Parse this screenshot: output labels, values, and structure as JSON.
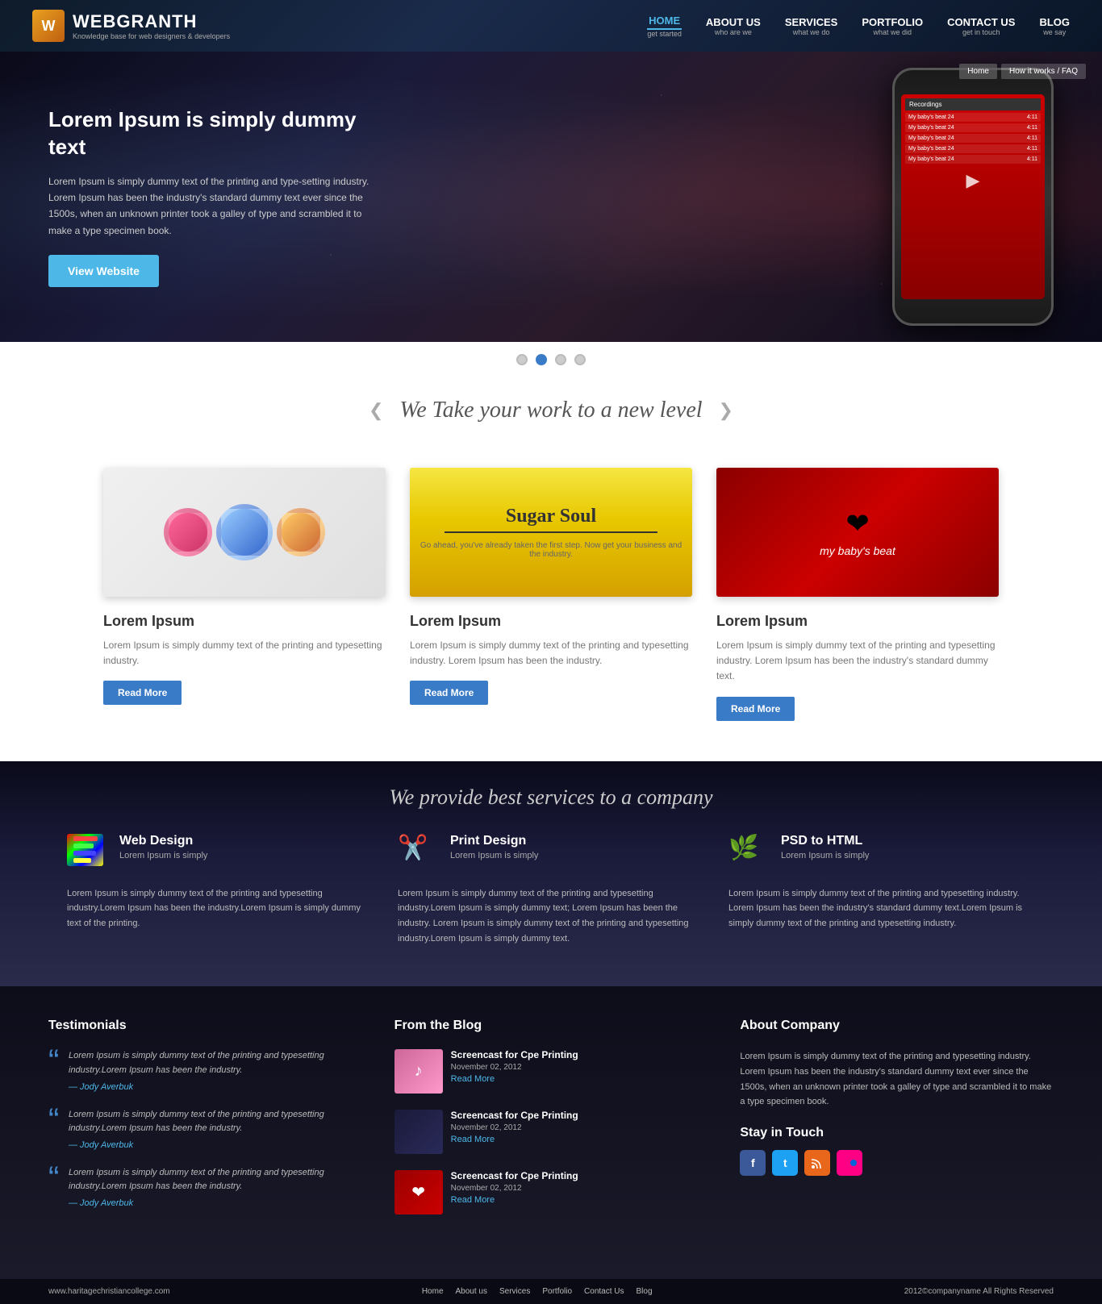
{
  "header": {
    "logo_letter": "W",
    "brand_name": "WEBGRANTH",
    "tagline": "Knowledge base for web designers & developers",
    "nav": [
      {
        "label": "HOME",
        "sub": "get started",
        "active": true
      },
      {
        "label": "ABOUT US",
        "sub": "who are we",
        "active": false
      },
      {
        "label": "SERVICES",
        "sub": "what we do",
        "active": false
      },
      {
        "label": "PORTFOLIO",
        "sub": "what we did",
        "active": false
      },
      {
        "label": "CONTACT US",
        "sub": "get in touch",
        "active": false
      },
      {
        "label": "BLOG",
        "sub": "we say",
        "active": false
      }
    ]
  },
  "hero": {
    "title": "Lorem Ipsum is simply dummy text",
    "body": "Lorem Ipsum is simply dummy text of the printing and type-setting industry. Lorem Ipsum has been the industry's standard dummy text ever since the 1500s, when an unknown printer took a galley of type and scrambled it to make a type specimen book.",
    "cta": "View Website",
    "tab1": "Home",
    "tab2": "How it works / FAQ"
  },
  "slider_dots": [
    "dot1",
    "dot2",
    "dot3",
    "dot4"
  ],
  "tagline1": "We Take your work to a new level",
  "portfolio": {
    "cards": [
      {
        "title": "Lorem Ipsum",
        "body": "Lorem Ipsum is simply dummy text of the printing and typesetting industry.",
        "btn": "Read More"
      },
      {
        "title": "Lorem Ipsum",
        "body": "Lorem Ipsum is simply dummy text of the printing and typesetting industry. Lorem Ipsum has been the industry.",
        "btn": "Read More"
      },
      {
        "title": "Lorem Ipsum",
        "body": "Lorem Ipsum is simply dummy text of the printing and typesetting industry. Lorem Ipsum has been the industry's standard dummy text.",
        "btn": "Read More"
      }
    ]
  },
  "services": {
    "tagline": "We provide best services to a company",
    "items": [
      {
        "title": "Web Design",
        "sub": "Lorem Ipsum is simply",
        "body": "Lorem Ipsum is simply dummy text of the printing and typesetting industry.Lorem Ipsum has been the industry.Lorem Ipsum is simply dummy text of the printing."
      },
      {
        "title": "Print Design",
        "sub": "Lorem Ipsum is simply",
        "body": "Lorem Ipsum is simply dummy text of the printing and typesetting industry.Lorem Ipsum is simply dummy text; Lorem Ipsum has been the industry. Lorem Ipsum is simply dummy text of the printing and typesetting industry.Lorem Ipsum is simply dummy text."
      },
      {
        "title": "PSD to HTML",
        "sub": "Lorem Ipsum is simply",
        "body": "Lorem Ipsum is simply dummy text of the printing and typesetting industry. Lorem Ipsum has been the industry's standard dummy text.Lorem Ipsum is simply dummy text of the printing and typesetting industry."
      }
    ]
  },
  "footer": {
    "testimonials_title": "Testimonials",
    "testimonials": [
      {
        "text": "Lorem Ipsum is simply dummy text of the printing and typesetting industry.Lorem Ipsum has been the industry.",
        "author": "— Jody Averbuk"
      },
      {
        "text": "Lorem Ipsum is simply dummy text of the printing and typesetting industry.Lorem Ipsum has been the industry.",
        "author": "— Jody Averbuk"
      },
      {
        "text": "Lorem Ipsum is simply dummy text of the printing and typesetting industry.Lorem Ipsum has been the industry.",
        "author": "— Jody Averbuk"
      }
    ],
    "blog_title": "From the Blog",
    "blog_posts": [
      {
        "title": "Screencast for Cpe Printing",
        "date": "November 02, 2012",
        "link": "Read More"
      },
      {
        "title": "Screencast for Cpe Printing",
        "date": "November 02, 2012",
        "link": "Read More"
      },
      {
        "title": "Screencast for Cpe Printing",
        "date": "November 02, 2012",
        "link": "Read More"
      }
    ],
    "about_title": "About Company",
    "about_text": "Lorem Ipsum is simply dummy text of the printing and typesetting industry. Lorem Ipsum has been the industry's standard dummy text ever since the 1500s, when an unknown printer took a galley of type and scrambled it to make a type specimen book.",
    "stay_touch_title": "Stay in Touch",
    "social": [
      "f",
      "t",
      "rss",
      "flickr"
    ]
  },
  "footer_bottom": {
    "url": "www.haritagechristiancollege.com",
    "nav_links": [
      "Home",
      "About us",
      "Services",
      "Portfolio",
      "Contact Us",
      "Blog"
    ],
    "copyright": "2012©companyname All Rights Reserved"
  }
}
